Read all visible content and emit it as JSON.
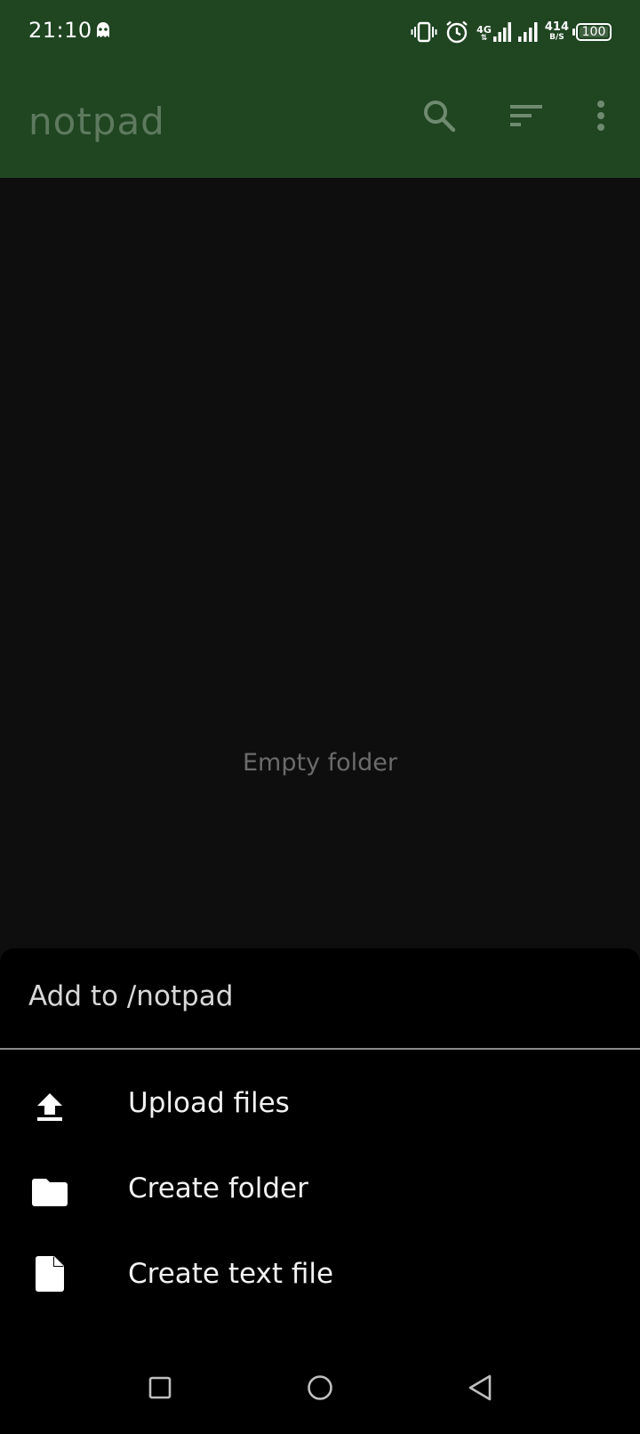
{
  "status_bar": {
    "time": "21:10",
    "network_type": "4G",
    "net_speed_value": "414",
    "net_speed_unit": "B/S",
    "battery_level": "100",
    "icons": [
      "notification-ghost-icon",
      "vibrate-icon",
      "alarm-icon",
      "signal-4g-icon",
      "signal-icon",
      "battery-icon"
    ]
  },
  "app_bar": {
    "title": "notpad",
    "actions": [
      "search-icon",
      "sort-icon",
      "more-vert-icon"
    ],
    "colors": {
      "background": "#1f4521",
      "title": "#5d7a5e",
      "icon": "#6e8a6f"
    }
  },
  "content": {
    "empty_message": "Empty folder"
  },
  "bottom_sheet": {
    "title": "Add to /notpad",
    "items": [
      {
        "label": "Upload files",
        "icon": "upload-icon"
      },
      {
        "label": "Create folder",
        "icon": "folder-icon"
      },
      {
        "label": "Create text file",
        "icon": "file-icon"
      }
    ]
  },
  "nav_bar": {
    "buttons": [
      "recents-square-icon",
      "home-circle-icon",
      "back-triangle-icon"
    ]
  }
}
